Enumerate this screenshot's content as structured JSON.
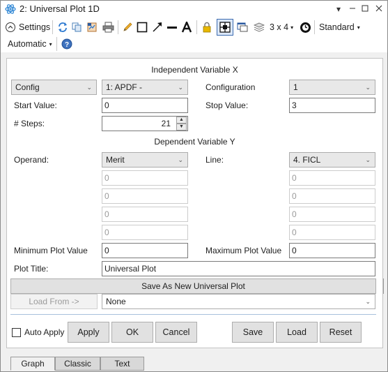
{
  "window": {
    "title": "2: Universal Plot 1D",
    "controls": [
      "chevron-down",
      "minimize",
      "maximize",
      "close"
    ]
  },
  "toolbar": {
    "settings_label": "Settings",
    "layout_label": "3 x 4",
    "standard_label": "Standard",
    "automatic_label": "Automatic",
    "icons": [
      "refresh-icon",
      "copy-icon",
      "export-icon",
      "print-icon",
      "pencil-icon",
      "rectangle-icon",
      "arrow-line-icon",
      "line-icon",
      "text-icon",
      "lock-icon",
      "grid-select-icon",
      "window-icon",
      "layers-icon",
      "clock-icon",
      "help-icon"
    ]
  },
  "independent": {
    "header": "Independent Variable X",
    "type_select": "Config",
    "operand_select": "1: APDF -",
    "configuration_label": "Configuration",
    "configuration_value": "1",
    "start_label": "Start Value:",
    "start_value": "0",
    "stop_label": "Stop Value:",
    "stop_value": "3",
    "steps_label": "# Steps:",
    "steps_value": "21"
  },
  "dependent": {
    "header": "Dependent Variable Y",
    "operand_label": "Operand:",
    "operand_value": "Merit",
    "line_label": "Line:",
    "line_value": "4. FICL",
    "left_params": [
      "0",
      "0",
      "0",
      "0"
    ],
    "right_params": [
      "0",
      "0",
      "0",
      "0"
    ],
    "min_label": "Minimum Plot Value",
    "min_value": "0",
    "max_label": "Maximum Plot Value",
    "max_value": "0",
    "title_label": "Plot Title:",
    "title_value": "Universal Plot"
  },
  "actions": {
    "save_new": "Save As New Universal Plot",
    "load_from": "Load From ->",
    "load_from_select": "None",
    "auto_apply": "Auto Apply",
    "apply": "Apply",
    "ok": "OK",
    "cancel": "Cancel",
    "save": "Save",
    "load": "Load",
    "reset": "Reset"
  },
  "tabs": [
    "Graph",
    "Classic",
    "Text"
  ],
  "colors": {
    "accent_blue": "#2b78d0",
    "divider": "#a8c0dc",
    "disabled_text": "#9a9a9a"
  }
}
